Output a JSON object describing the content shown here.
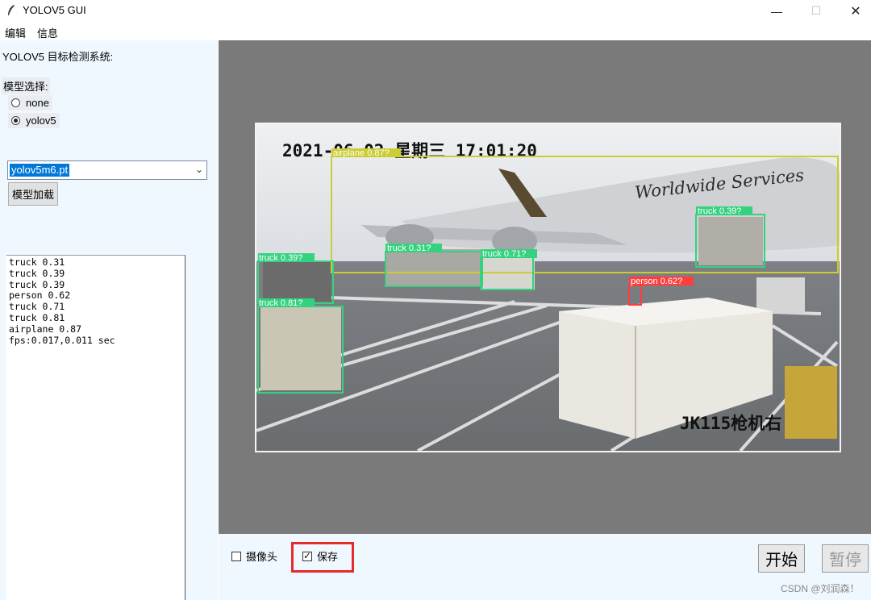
{
  "window": {
    "title": "YOLOV5 GUI",
    "minimize_glyph": "—",
    "maximize_glyph": "☐",
    "close_glyph": "✕"
  },
  "menu": {
    "edit": "编辑",
    "info": "信息"
  },
  "left": {
    "system_title": "YOLOV5 目标检测系统:",
    "model_label": "模型选择:",
    "radios": [
      {
        "label": "none",
        "checked": false
      },
      {
        "label": "yolov5",
        "checked": true
      }
    ],
    "weights_value": "yolov5m6.pt",
    "load_button": "模型加载",
    "log_lines": [
      "truck 0.31",
      "truck 0.39",
      "truck 0.39",
      "person 0.62",
      "truck 0.71",
      "truck 0.81",
      "airplane 0.87",
      "fps:0.017,0.011 sec"
    ]
  },
  "image": {
    "timestamp_overlay": "2021-06-02 星期三 17:01:20",
    "camera_overlay": "JK115枪机右",
    "plane_livery": "Worldwide Services",
    "detections": [
      {
        "label": "airplane 0.87?",
        "color": "#cccc33"
      },
      {
        "label": "truck 0.39?",
        "color": "#34d27e"
      },
      {
        "label": "truck 0.31?",
        "color": "#34d27e"
      },
      {
        "label": "truck 0.71?",
        "color": "#34d27e"
      },
      {
        "label": "truck 0.39?",
        "color": "#34d27e"
      },
      {
        "label": "truck 0.81?",
        "color": "#34d27e"
      },
      {
        "label": "person 0.62?",
        "color": "#ff3d3d"
      }
    ]
  },
  "bottom": {
    "camera_label": "摄像头",
    "camera_checked": false,
    "save_label": "保存",
    "save_checked": true,
    "start_button": "开始",
    "pause_button": "暂停",
    "watermark": "CSDN @刘润森！"
  },
  "colors": {
    "left_panel_bg": "#f0f8ff",
    "view_bg": "#7a7a7a",
    "highlight": "#e52a2a",
    "selection": "#0078d7"
  }
}
